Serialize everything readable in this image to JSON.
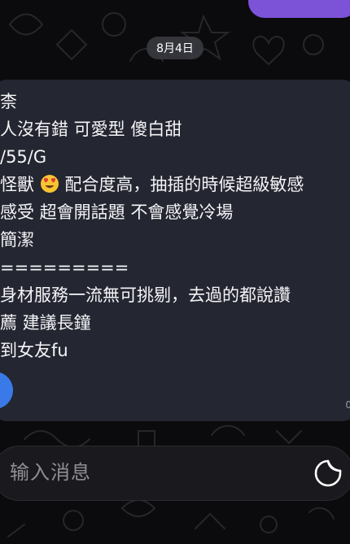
{
  "top_message": {
    "label": ""
  },
  "date_chip": "8月4日",
  "message": {
    "lines": [
      "柰",
      "人沒有錯 可愛型 傻白甜",
      "/55/G",
      "怪獸",
      "配合度高，抽插的時候超級敏感",
      "感受 超會開話題 不會感覺冷場",
      "簡潔",
      "=========",
      "身材服務一流無可挑剔，去過的都說讚",
      "薦 建議長鐘",
      "到女友fu"
    ],
    "emoji": "heart-eyes-emoji",
    "time_fragment": "0"
  },
  "composer": {
    "placeholder": "输入消息",
    "icon": "sticker-icon"
  },
  "colors": {
    "background": "#0b0b0d",
    "bubble": "#242631",
    "accent": "#7c52d6",
    "avatar": "#3a7ae8"
  }
}
